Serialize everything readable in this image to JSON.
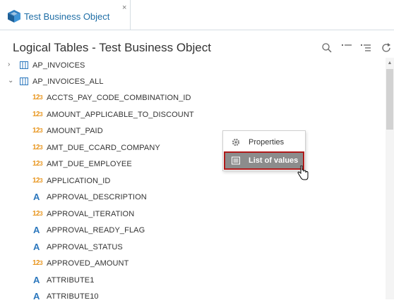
{
  "tab": {
    "label": "Test Business Object",
    "close": "×",
    "icon": "cube-icon"
  },
  "panel": {
    "title": "Logical Tables - Test Business Object"
  },
  "toolbar": {
    "icons": [
      "search-icon",
      "collapse-all-icon",
      "expand-all-icon",
      "refresh-icon"
    ]
  },
  "tree": {
    "tables": [
      {
        "label": "AP_INVOICES",
        "expanded": false
      },
      {
        "label": "AP_INVOICES_ALL",
        "expanded": true
      }
    ],
    "columns": [
      {
        "label": "ACCTS_PAY_CODE_COMBINATION_ID",
        "type": "numeric"
      },
      {
        "label": "AMOUNT_APPLICABLE_TO_DISCOUNT",
        "type": "numeric"
      },
      {
        "label": "AMOUNT_PAID",
        "type": "numeric"
      },
      {
        "label": "AMT_DUE_CCARD_COMPANY",
        "type": "numeric"
      },
      {
        "label": "AMT_DUE_EMPLOYEE",
        "type": "numeric"
      },
      {
        "label": "APPLICATION_ID",
        "type": "numeric"
      },
      {
        "label": "APPROVAL_DESCRIPTION",
        "type": "text"
      },
      {
        "label": "APPROVAL_ITERATION",
        "type": "numeric"
      },
      {
        "label": "APPROVAL_READY_FLAG",
        "type": "text"
      },
      {
        "label": "APPROVAL_STATUS",
        "type": "text"
      },
      {
        "label": "APPROVED_AMOUNT",
        "type": "numeric"
      },
      {
        "label": "ATTRIBUTE1",
        "type": "text"
      },
      {
        "label": "ATTRIBUTE10",
        "type": "text"
      }
    ],
    "num_icon": {
      "main": "12",
      "sub": "3"
    },
    "text_icon": "A"
  },
  "context_menu": {
    "properties": "Properties",
    "list_of_values": "List of values"
  },
  "colors": {
    "accent": "#1f6ea6",
    "numeric_icon": "#e8941a",
    "text_icon": "#2b77bd",
    "highlight_border": "#b01a1a"
  }
}
